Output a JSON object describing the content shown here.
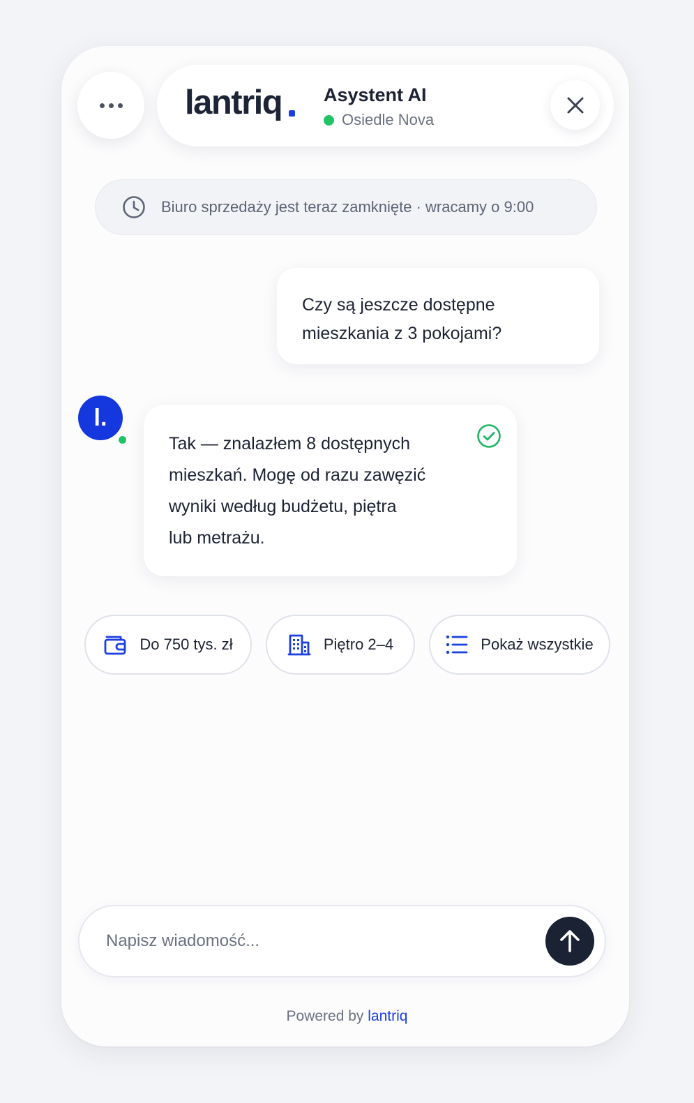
{
  "header": {
    "logo_text": "lantriq",
    "title": "Asystent AI",
    "subtitle": "Osiedle Nova",
    "status_color": "#20c466",
    "menu_icon": "more-horizontal-icon",
    "close_icon": "close-icon"
  },
  "notice": {
    "icon": "clock-icon",
    "text": "Biuro sprzedaży jest teraz zamknięte · wracamy o 9:00"
  },
  "messages": [
    {
      "role": "user",
      "lines": [
        "Czy są jeszcze dostępne",
        "mieszkania z 3 pokojami?"
      ]
    },
    {
      "role": "assistant",
      "avatar_letter": "l.",
      "status_icon": "check-circle-icon",
      "lines": [
        "Tak — znalazłem 8 dostępnych",
        "mieszkań. Mogę od razu zawęzić",
        "wyniki według budżetu, piętra",
        "lub metrażu."
      ]
    }
  ],
  "quick_replies": [
    {
      "label": "Do 750 tys. zł",
      "icon": "wallet-icon"
    },
    {
      "label": "Piętro 2–4",
      "icon": "building-icon"
    },
    {
      "label": "Pokaż wszystkie",
      "icon": "list-icon"
    }
  ],
  "composer": {
    "placeholder": "Napisz wiadomość...",
    "value": "",
    "send_icon": "arrow-up-icon"
  },
  "footer": {
    "prefix": "Powered by",
    "brand": "lantriq"
  },
  "colors": {
    "accent": "#1b3fe0",
    "online": "#20c466",
    "dark": "#1a2233"
  }
}
